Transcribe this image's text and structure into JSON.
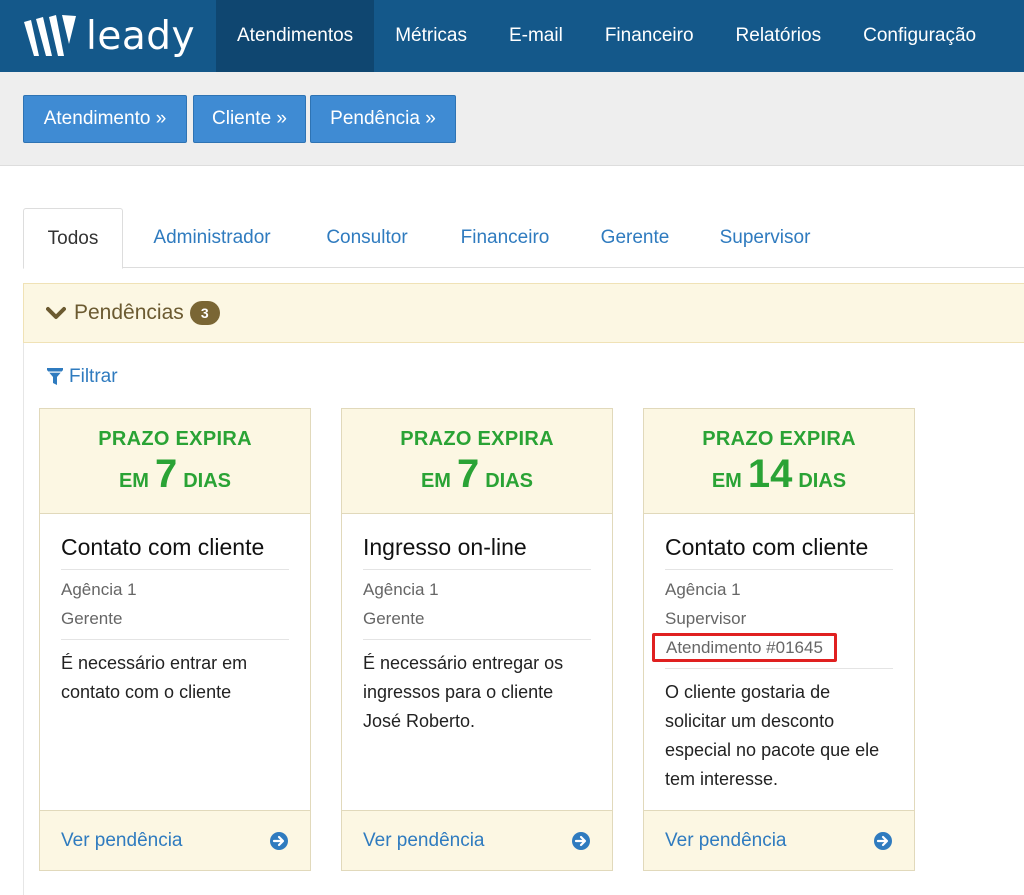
{
  "brand": {
    "name": "leady"
  },
  "nav": {
    "items": [
      {
        "label": "Atendimentos",
        "active": true
      },
      {
        "label": "Métricas"
      },
      {
        "label": "E-mail"
      },
      {
        "label": "Financeiro"
      },
      {
        "label": "Relatórios"
      },
      {
        "label": "Configuração"
      }
    ]
  },
  "actions": {
    "atendimento": "Atendimento »",
    "cliente": "Cliente »",
    "pendencia": "Pendência »"
  },
  "tabs": [
    "Todos",
    "Administrador",
    "Consultor",
    "Financeiro",
    "Gerente",
    "Supervisor"
  ],
  "panel": {
    "title": "Pendências",
    "count": "3"
  },
  "filter": {
    "label": "Filtrar"
  },
  "cards": [
    {
      "prazo_line1": "PRAZO EXPIRA",
      "em": "EM",
      "days": "7",
      "dias": "DIAS",
      "title": "Contato com cliente",
      "agencia": "Agência 1",
      "role": "Gerente",
      "description": "É necessário entrar em contato com o cliente",
      "link": "Ver pendência"
    },
    {
      "prazo_line1": "PRAZO EXPIRA",
      "em": "EM",
      "days": "7",
      "dias": "DIAS",
      "title": "Ingresso on-line",
      "agencia": "Agência 1",
      "role": "Gerente",
      "description": "É necessário entregar os ingressos para o cliente José Roberto.",
      "link": "Ver pendência"
    },
    {
      "prazo_line1": "PRAZO EXPIRA",
      "em": "EM",
      "days": "14",
      "dias": "DIAS",
      "title": "Contato com cliente",
      "agencia": "Agência 1",
      "role": "Supervisor",
      "atendimento": "Atendimento #01645",
      "description": "O cliente gostaria de solicitar um desconto especial no pacote que ele tem interesse.",
      "link": "Ver pendência"
    }
  ],
  "colors": {
    "nav_bg": "#14588a",
    "nav_active": "#0f4670",
    "button_bg": "#3f8bd3",
    "link": "#2f7bbf",
    "deadline_green": "#2aa335",
    "panel_bg": "#fcf7e3",
    "highlight_red": "#e02020"
  }
}
